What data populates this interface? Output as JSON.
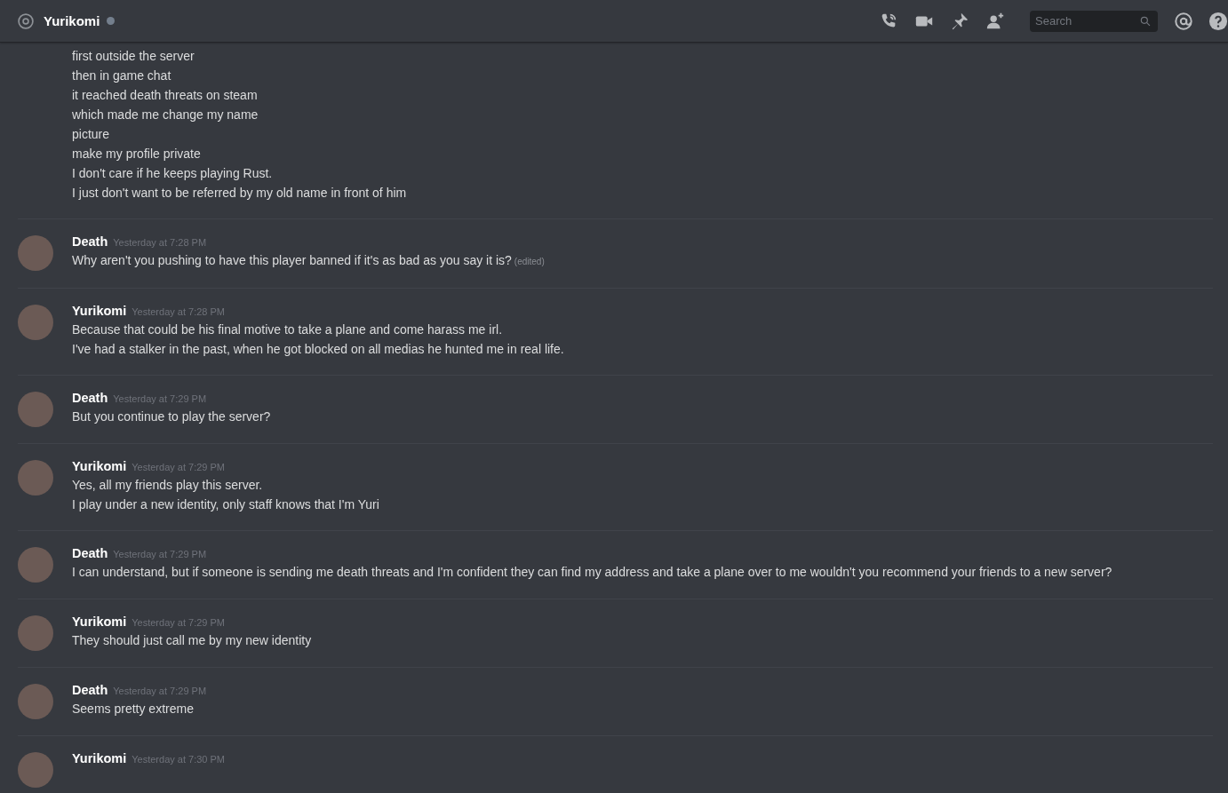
{
  "header": {
    "title": "Yurikomi",
    "search": {
      "placeholder": "Search"
    }
  },
  "messages": [
    {
      "lines": [
        "first outside the server",
        "then in game chat",
        "it reached death threats on steam",
        "which made me change my name",
        "picture",
        "make my profile private",
        "I don't care if he keeps playing Rust.",
        "I just don't want to be referred by my old name in front of him"
      ]
    },
    {
      "author": "Death",
      "timestamp": "Yesterday at 7:28 PM",
      "lines": [
        "Why aren't you pushing to have this player banned if it's as bad as you say it is?"
      ],
      "edited": "(edited)"
    },
    {
      "author": "Yurikomi",
      "timestamp": "Yesterday at 7:28 PM",
      "lines": [
        "Because that could be his final motive to take a plane and come harass me irl.",
        "I've had a stalker in the past, when he got blocked on all medias he hunted me in real life."
      ]
    },
    {
      "author": "Death",
      "timestamp": "Yesterday at 7:29 PM",
      "lines": [
        "But you continue to play the server?"
      ]
    },
    {
      "author": "Yurikomi",
      "timestamp": "Yesterday at 7:29 PM",
      "lines": [
        "Yes, all my friends play this server.",
        "I play under a new identity, only staff knows that I'm Yuri"
      ]
    },
    {
      "author": "Death",
      "timestamp": "Yesterday at 7:29 PM",
      "lines": [
        "I can understand, but if someone is sending me death threats and I'm confident they can find my address and take a plane over to me wouldn't you recommend your friends to a new server?"
      ]
    },
    {
      "author": "Yurikomi",
      "timestamp": "Yesterday at 7:29 PM",
      "lines": [
        "They should just call me by my new identity"
      ]
    },
    {
      "author": "Death",
      "timestamp": "Yesterday at 7:29 PM",
      "lines": [
        "Seems pretty extreme"
      ]
    },
    {
      "author": "Yurikomi",
      "timestamp": "Yesterday at 7:30 PM"
    }
  ]
}
